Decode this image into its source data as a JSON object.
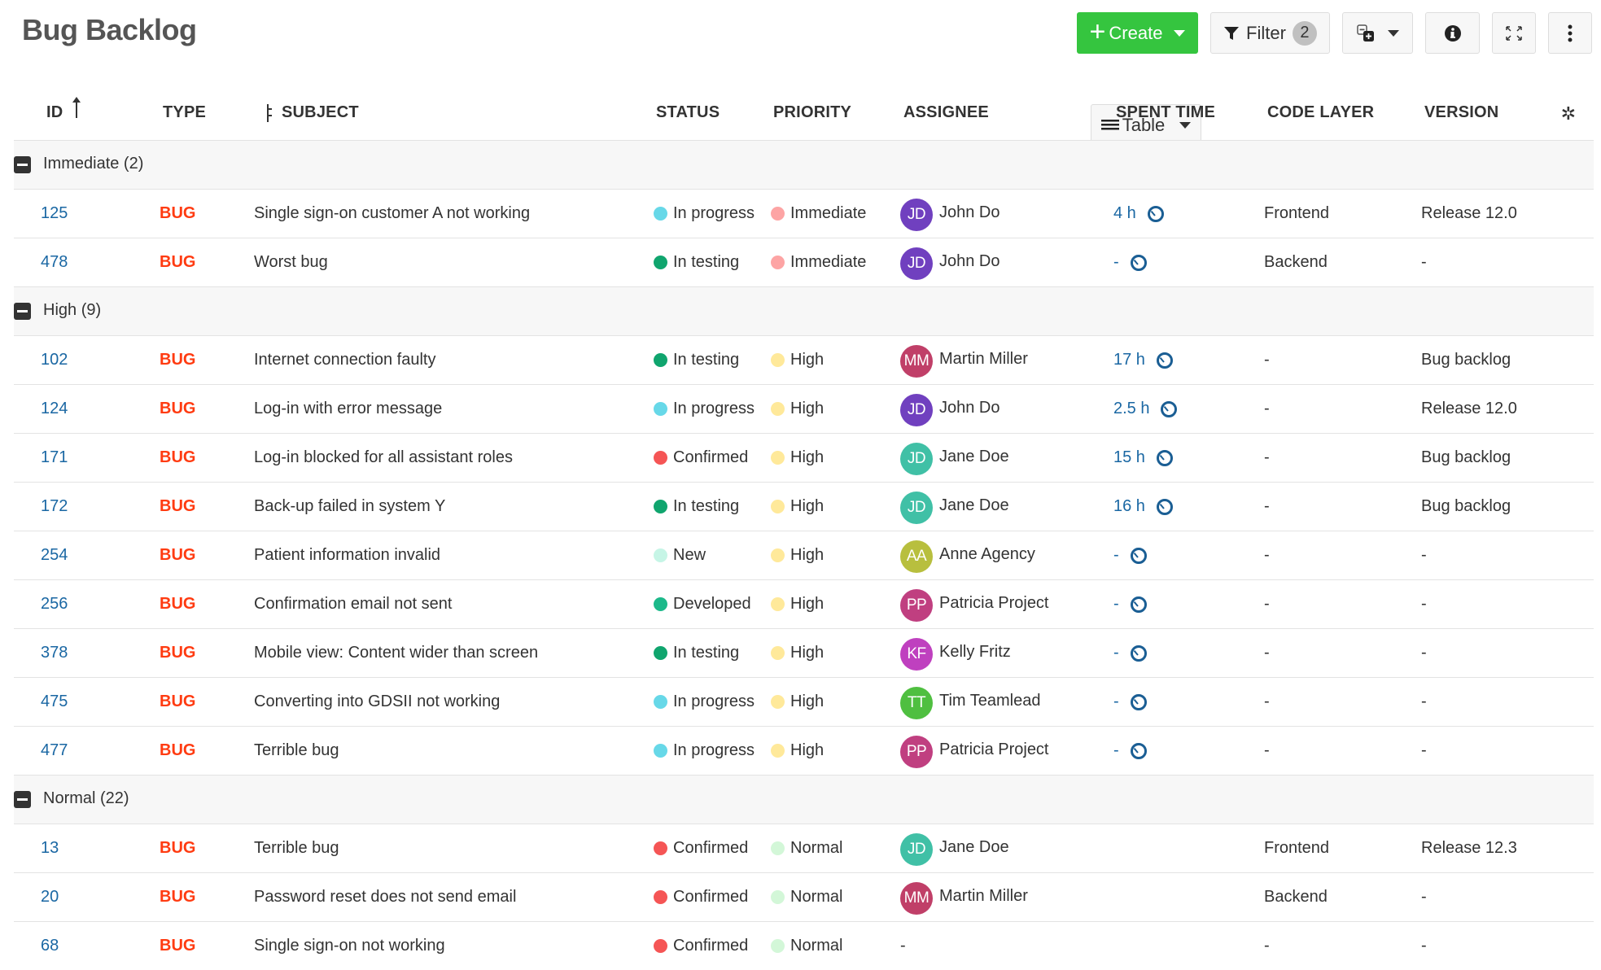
{
  "page": {
    "title": "Bug Backlog"
  },
  "toolbar": {
    "create_label": "Create",
    "filter_label": "Filter",
    "filter_count": "2",
    "view_label": "Table"
  },
  "columns": {
    "id": "ID",
    "type": "TYPE",
    "subject": "SUBJECT",
    "status": "STATUS",
    "priority": "PRIORITY",
    "assignee": "ASSIGNEE",
    "spent_time": "SPENT TIME",
    "code_layer": "CODE LAYER",
    "version": "VERSION"
  },
  "colors": {
    "status": {
      "In progress": "#67d8e8",
      "In testing": "#10a56e",
      "Confirmed": "#f55555",
      "New": "#c6f5e6",
      "Developed": "#1cb98a"
    },
    "priority": {
      "Immediate": "#fda4a4",
      "High": "#ffe99a",
      "Normal": "#d3f7d8"
    },
    "avatar": {
      "JD-John": "#7040bf",
      "MM": "#c03f68",
      "JD-Jane": "#40c0a6",
      "AA": "#b8bf3e",
      "PP": "#c03f80",
      "KF": "#bf40bf",
      "TT": "#4fbf40"
    }
  },
  "groups": [
    {
      "label": "Immediate (2)",
      "rows": [
        {
          "id": "125",
          "type": "BUG",
          "subject": "Single sign-on customer A not working",
          "status": "In progress",
          "priority": "Immediate",
          "assignee_initials": "JD",
          "assignee": "John Do",
          "avatar_key": "JD-John",
          "spent": "4 h",
          "show_clock": true,
          "code_layer": "Frontend",
          "version": "Release 12.0"
        },
        {
          "id": "478",
          "type": "BUG",
          "subject": "Worst bug",
          "status": "In testing",
          "priority": "Immediate",
          "assignee_initials": "JD",
          "assignee": "John Do",
          "avatar_key": "JD-John",
          "spent": "-",
          "show_clock": true,
          "code_layer": "Backend",
          "version": "-"
        }
      ]
    },
    {
      "label": "High (9)",
      "rows": [
        {
          "id": "102",
          "type": "BUG",
          "subject": "Internet connection faulty",
          "status": "In testing",
          "priority": "High",
          "assignee_initials": "MM",
          "assignee": "Martin Miller",
          "avatar_key": "MM",
          "spent": "17 h",
          "show_clock": true,
          "code_layer": "-",
          "version": "Bug backlog"
        },
        {
          "id": "124",
          "type": "BUG",
          "subject": "Log-in with error message",
          "status": "In progress",
          "priority": "High",
          "assignee_initials": "JD",
          "assignee": "John Do",
          "avatar_key": "JD-John",
          "spent": "2.5 h",
          "show_clock": true,
          "code_layer": "-",
          "version": "Release 12.0"
        },
        {
          "id": "171",
          "type": "BUG",
          "subject": "Log-in blocked for all assistant roles",
          "status": "Confirmed",
          "priority": "High",
          "assignee_initials": "JD",
          "assignee": "Jane Doe",
          "avatar_key": "JD-Jane",
          "spent": "15 h",
          "show_clock": true,
          "code_layer": "-",
          "version": "Bug backlog"
        },
        {
          "id": "172",
          "type": "BUG",
          "subject": "Back-up failed in system Y",
          "status": "In testing",
          "priority": "High",
          "assignee_initials": "JD",
          "assignee": "Jane Doe",
          "avatar_key": "JD-Jane",
          "spent": "16 h",
          "show_clock": true,
          "code_layer": "-",
          "version": "Bug backlog"
        },
        {
          "id": "254",
          "type": "BUG",
          "subject": "Patient information invalid",
          "status": "New",
          "priority": "High",
          "assignee_initials": "AA",
          "assignee": "Anne Agency",
          "avatar_key": "AA",
          "spent": "-",
          "show_clock": true,
          "code_layer": "-",
          "version": "-"
        },
        {
          "id": "256",
          "type": "BUG",
          "subject": "Confirmation email not sent",
          "status": "Developed",
          "priority": "High",
          "assignee_initials": "PP",
          "assignee": "Patricia Project",
          "avatar_key": "PP",
          "spent": "-",
          "show_clock": true,
          "code_layer": "-",
          "version": "-"
        },
        {
          "id": "378",
          "type": "BUG",
          "subject": "Mobile view: Content wider than screen",
          "status": "In testing",
          "priority": "High",
          "assignee_initials": "KF",
          "assignee": "Kelly Fritz",
          "avatar_key": "KF",
          "spent": "-",
          "show_clock": true,
          "code_layer": "-",
          "version": "-"
        },
        {
          "id": "475",
          "type": "BUG",
          "subject": "Converting into GDSII not working",
          "status": "In progress",
          "priority": "High",
          "assignee_initials": "TT",
          "assignee": "Tim Teamlead",
          "avatar_key": "TT",
          "spent": "-",
          "show_clock": true,
          "code_layer": "-",
          "version": "-"
        },
        {
          "id": "477",
          "type": "BUG",
          "subject": "Terrible bug",
          "status": "In progress",
          "priority": "High",
          "assignee_initials": "PP",
          "assignee": "Patricia Project",
          "avatar_key": "PP",
          "spent": "-",
          "show_clock": true,
          "code_layer": "-",
          "version": "-"
        }
      ]
    },
    {
      "label": "Normal (22)",
      "rows": [
        {
          "id": "13",
          "type": "BUG",
          "subject": "Terrible bug",
          "status": "Confirmed",
          "priority": "Normal",
          "assignee_initials": "JD",
          "assignee": "Jane Doe",
          "avatar_key": "JD-Jane",
          "spent": "",
          "show_clock": false,
          "code_layer": "Frontend",
          "version": "Release 12.3"
        },
        {
          "id": "20",
          "type": "BUG",
          "subject": "Password reset does not send email",
          "status": "Confirmed",
          "priority": "Normal",
          "assignee_initials": "MM",
          "assignee": "Martin Miller",
          "avatar_key": "MM",
          "spent": "",
          "show_clock": false,
          "code_layer": "Backend",
          "version": "-"
        },
        {
          "id": "68",
          "type": "BUG",
          "subject": "Single sign-on not working",
          "status": "Confirmed",
          "priority": "Normal",
          "assignee_initials": "",
          "assignee": "-",
          "avatar_key": "",
          "spent": "",
          "show_clock": false,
          "code_layer": "-",
          "version": "-"
        }
      ]
    }
  ]
}
